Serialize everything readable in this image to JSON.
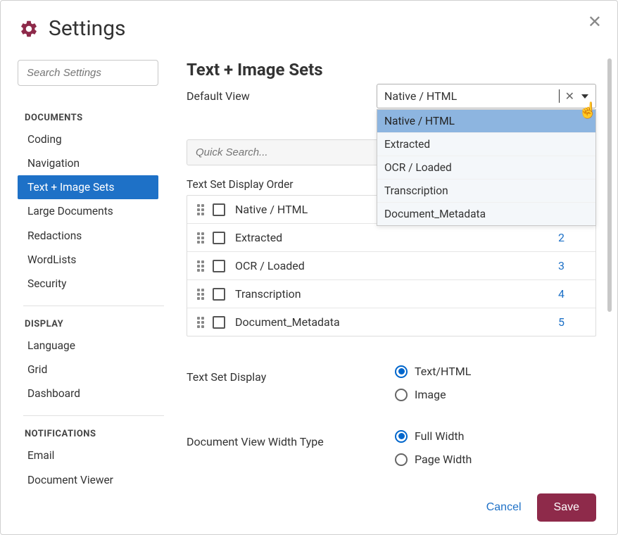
{
  "header": {
    "title": "Settings"
  },
  "sidebar": {
    "search_placeholder": "Search Settings",
    "sections": [
      {
        "label": "DOCUMENTS",
        "items": [
          "Coding",
          "Navigation",
          "Text + Image Sets",
          "Large Documents",
          "Redactions",
          "WordLists",
          "Security"
        ],
        "active_index": 2
      },
      {
        "label": "DISPLAY",
        "items": [
          "Language",
          "Grid",
          "Dashboard"
        ]
      },
      {
        "label": "NOTIFICATIONS",
        "items": [
          "Email",
          "Document Viewer"
        ]
      }
    ]
  },
  "main": {
    "title": "Text + Image Sets",
    "default_view": {
      "label": "Default View",
      "value": "Native / HTML",
      "options": [
        "Native / HTML",
        "Extracted",
        "OCR / Loaded",
        "Transcription",
        "Document_Metadata"
      ],
      "highlight_index": 0
    },
    "quick_search_placeholder": "Quick Search...",
    "order": {
      "label": "Text Set Display Order",
      "rows": [
        {
          "name": "Native / HTML",
          "num": ""
        },
        {
          "name": "Extracted",
          "num": "2"
        },
        {
          "name": "OCR / Loaded",
          "num": "3"
        },
        {
          "name": "Transcription",
          "num": "4"
        },
        {
          "name": "Document_Metadata",
          "num": "5"
        }
      ]
    },
    "text_set_display": {
      "label": "Text Set Display",
      "options": [
        "Text/HTML",
        "Image"
      ],
      "selected_index": 0
    },
    "width_type": {
      "label": "Document View Width Type",
      "options": [
        "Full Width",
        "Page Width"
      ],
      "selected_index": 0
    }
  },
  "footer": {
    "cancel": "Cancel",
    "save": "Save"
  }
}
